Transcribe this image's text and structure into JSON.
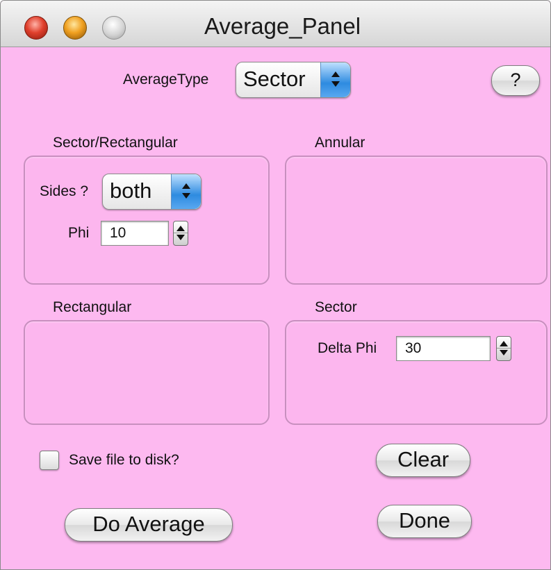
{
  "window": {
    "title": "Average_Panel"
  },
  "top": {
    "average_type_label": "AverageType",
    "average_type_value": "Sector",
    "help_label": "?"
  },
  "groups": {
    "sector_rect": {
      "title": "Sector/Rectangular",
      "sides_label": "Sides ?",
      "sides_value": "both",
      "phi_label": "Phi",
      "phi_value": "10"
    },
    "annular": {
      "title": "Annular"
    },
    "rectangular": {
      "title": "Rectangular"
    },
    "sector": {
      "title": "Sector",
      "delta_phi_label": "Delta Phi",
      "delta_phi_value": "30"
    }
  },
  "bottom": {
    "save_checkbox_label": "Save file to disk?",
    "save_checked": false,
    "clear_label": "Clear",
    "do_average_label": "Do Average",
    "done_label": "Done"
  },
  "colors": {
    "panel_background": "#fdb9f0",
    "popup_arrow_accent": "#2e8be0"
  }
}
